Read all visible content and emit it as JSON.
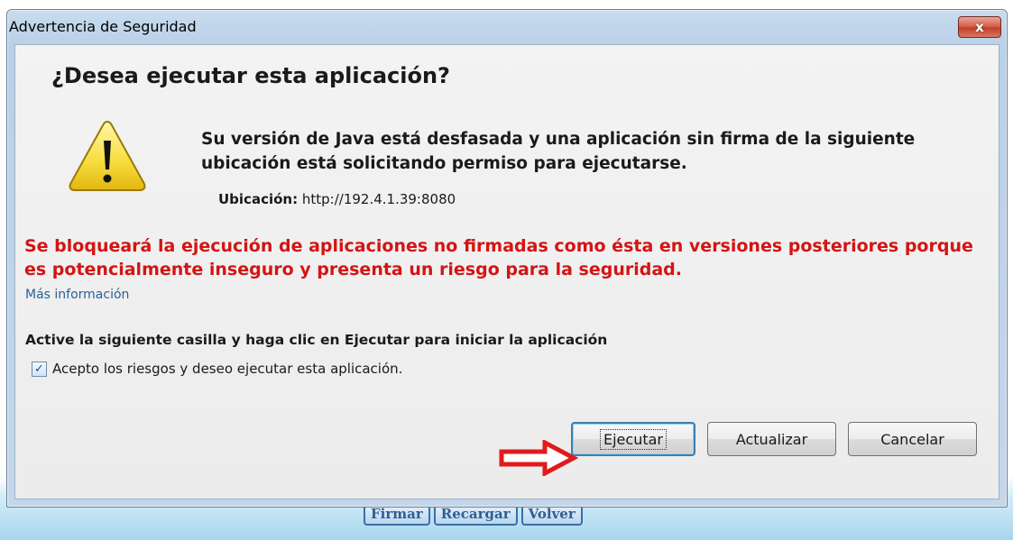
{
  "window": {
    "title": "Advertencia de Seguridad",
    "close_label": "x"
  },
  "dialog": {
    "heading": "¿Desea ejecutar esta aplicación?",
    "message": "Su versión de Java está desfasada y una aplicación sin firma de la siguiente ubicación está solicitando permiso para ejecutarse.",
    "location_label": "Ubicación:",
    "location_value": "http://192.4.1.39:8080",
    "warning": "Se bloqueará la ejecución de aplicaciones no firmadas como ésta en versiones posteriores porque es potencialmente inseguro y presenta un riesgo para la seguridad.",
    "more_info": "Más información",
    "instruction": "Active la siguiente casilla y haga clic en Ejecutar para iniciar la aplicación",
    "checkbox_label": "Acepto los riesgos y deseo ejecutar esta aplicación.",
    "checkbox_checked": true,
    "buttons": {
      "run": "Ejecutar",
      "update": "Actualizar",
      "cancel": "Cancelar"
    }
  },
  "background": {
    "buttons": [
      "Firmar",
      "Recargar",
      "Volver"
    ]
  },
  "colors": {
    "warning_text": "#d41414",
    "link": "#2a5f98",
    "arrow": "#e01b1b",
    "close_button": "#c0402a"
  },
  "icons": {
    "warning": "warning-triangle-icon",
    "arrow": "red-arrow-icon",
    "close": "close-icon"
  }
}
